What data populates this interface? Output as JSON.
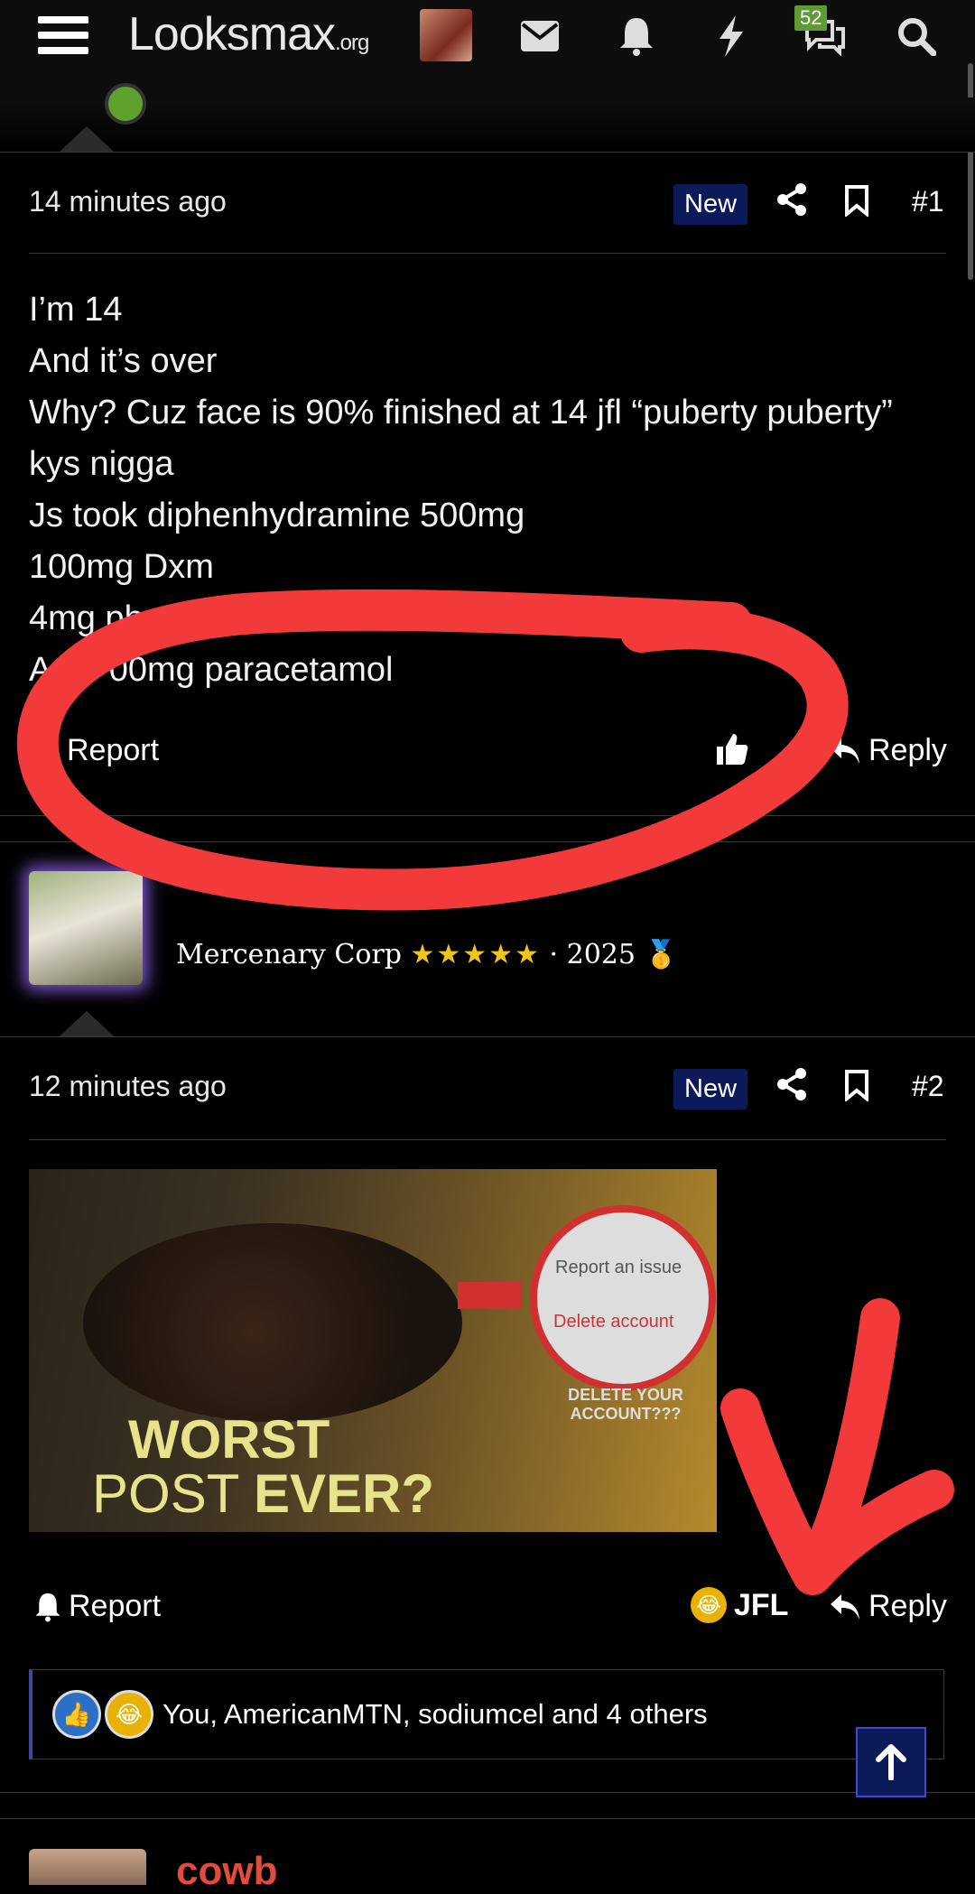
{
  "nav": {
    "logo_main": "Looksmax",
    "logo_suffix": ".org",
    "badge_count": "52",
    "icons": [
      "menu-icon",
      "envelope-icon",
      "bell-icon",
      "bolt-icon",
      "chat-icon",
      "search-icon"
    ]
  },
  "post1": {
    "time": "14 minutes ago",
    "badge": "New",
    "number": "#1",
    "lines": [
      "I’m 14",
      "And it’s over",
      "Why? Cuz face is 90% finished at 14 jfl “puberty puberty”",
      "kys nigga",
      "Js took diphenhydramine 500mg",
      "100mg Dxm",
      "4mg pheni",
      "An    00mg paracetamol"
    ],
    "report": "Report",
    "reply": "Reply"
  },
  "post2": {
    "user_title": "Mercenary Corp",
    "stars": "★★★★★",
    "year": "· 2025",
    "medal": "🥇",
    "time": "12 minutes ago",
    "badge": "New",
    "number": "#2",
    "meme": {
      "circle_line1": "Report an issue",
      "circle_line2": "Delete account",
      "delete_text": "DELETE YOUR ACCOUNT???",
      "worst": "WORST",
      "post": "POST",
      "ever": "EVER?"
    },
    "report": "Report",
    "reaction_label": "JFL",
    "reply": "Reply",
    "reactions_text": "You, AmericanMTN, sodiumcel and 4 others"
  },
  "next_post": {
    "name": "cowb"
  },
  "colors": {
    "accent_blue": "#0c1a5a",
    "online_green": "#5fa12f",
    "badge_green": "#5d9b33",
    "scribble_red": "#f23a3a",
    "next_name_red": "#e24c3c"
  }
}
